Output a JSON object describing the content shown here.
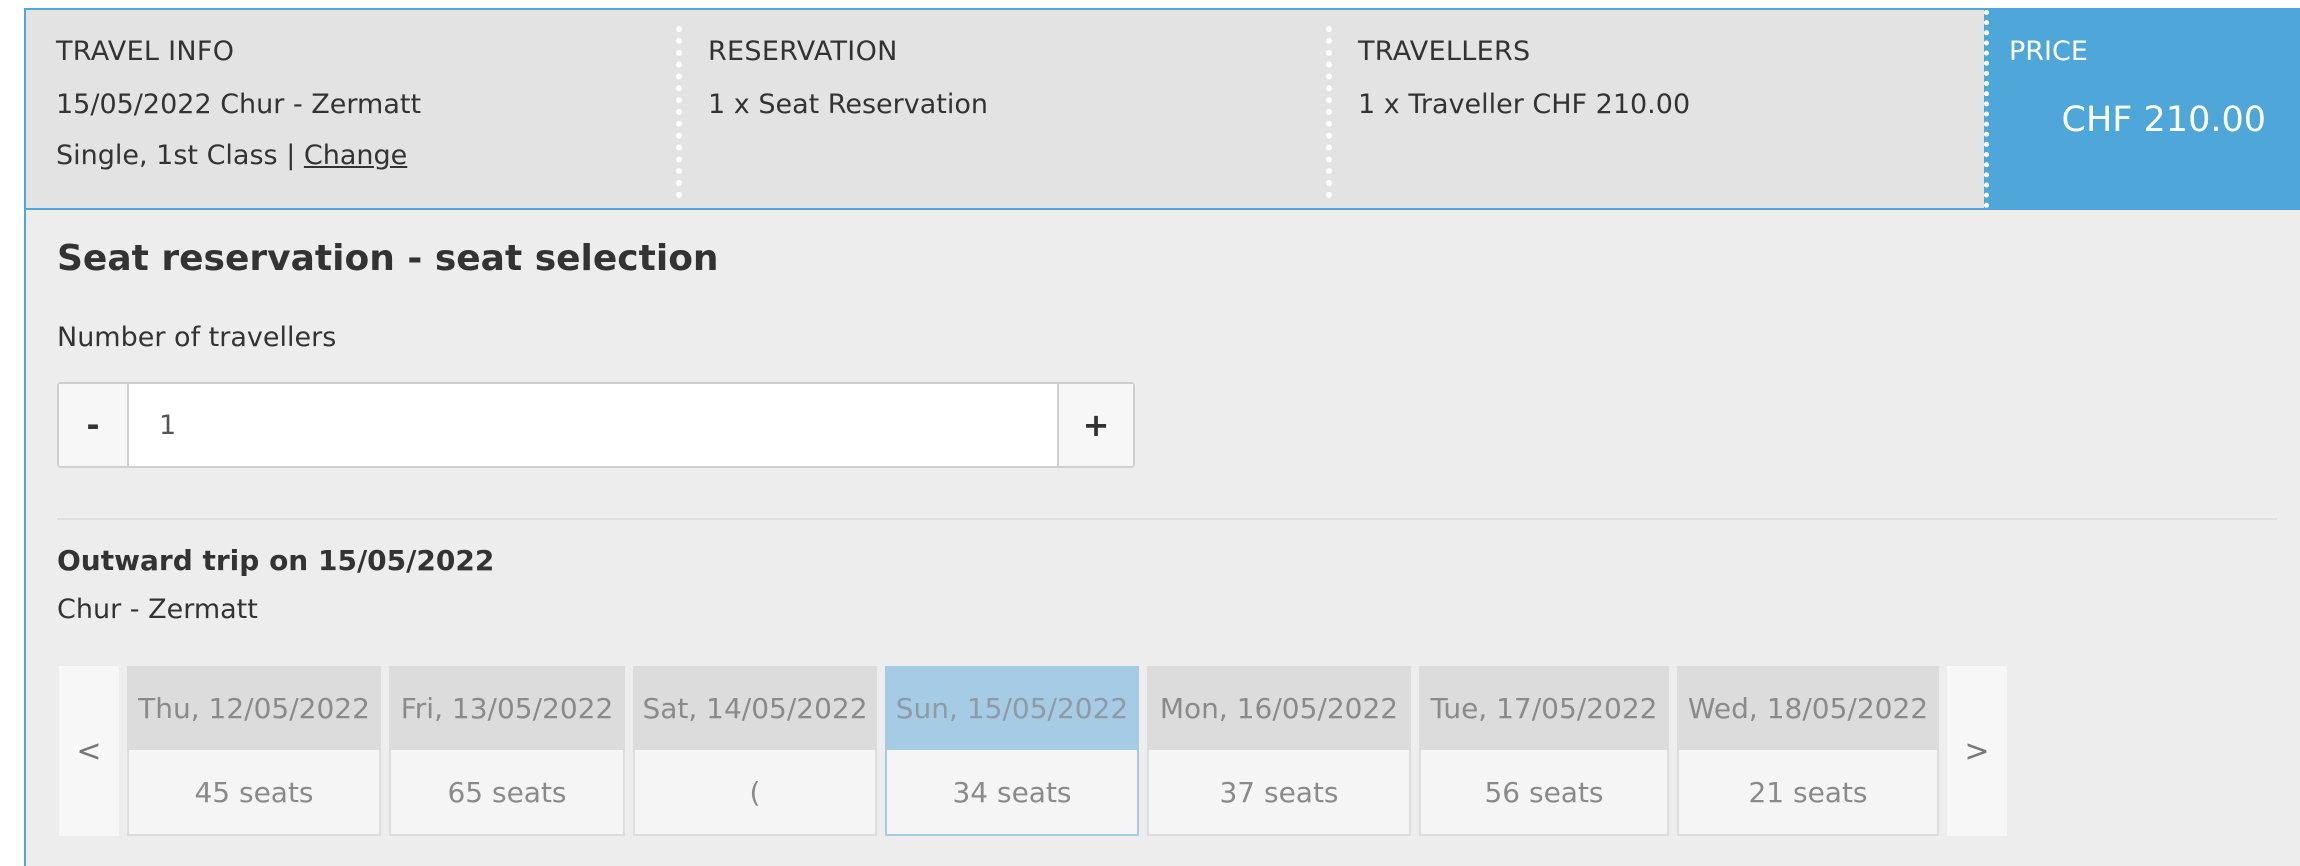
{
  "summary": {
    "travel_info": {
      "heading": "TRAVEL INFO",
      "date_route": "15/05/2022 Chur - Zermatt",
      "ticket_type": "Single, 1st Class | ",
      "change_link": "Change"
    },
    "reservation": {
      "heading": "RESERVATION",
      "line": "1 x Seat Reservation"
    },
    "travellers": {
      "heading": "TRAVELLERS",
      "line": "1 x Traveller CHF 210.00"
    },
    "price": {
      "heading": "PRICE",
      "value": "CHF 210.00"
    }
  },
  "main": {
    "title": "Seat reservation - seat selection",
    "travellers_label": "Number of travellers",
    "stepper": {
      "minus": "-",
      "plus": "+",
      "value": "1"
    },
    "trip_title": "Outward trip on 15/05/2022",
    "trip_route": "Chur - Zermatt"
  },
  "carousel": {
    "prev": "<",
    "next": ">",
    "days": [
      {
        "date": "Thu, 12/05/2022",
        "seats": "45 seats",
        "selected": false
      },
      {
        "date": "Fri, 13/05/2022",
        "seats": "65 seats",
        "selected": false
      },
      {
        "date": "Sat, 14/05/2022",
        "seats": "(",
        "selected": false
      },
      {
        "date": "Sun, 15/05/2022",
        "seats": "34 seats",
        "selected": true
      },
      {
        "date": "Mon, 16/05/2022",
        "seats": "37 seats",
        "selected": false
      },
      {
        "date": "Tue, 17/05/2022",
        "seats": "56 seats",
        "selected": false
      },
      {
        "date": "Wed, 18/05/2022",
        "seats": "21 seats",
        "selected": false
      }
    ]
  },
  "colors": {
    "accent": "#4ea7d8",
    "selected_day": "#a6cbe5",
    "background": "#ededed"
  }
}
